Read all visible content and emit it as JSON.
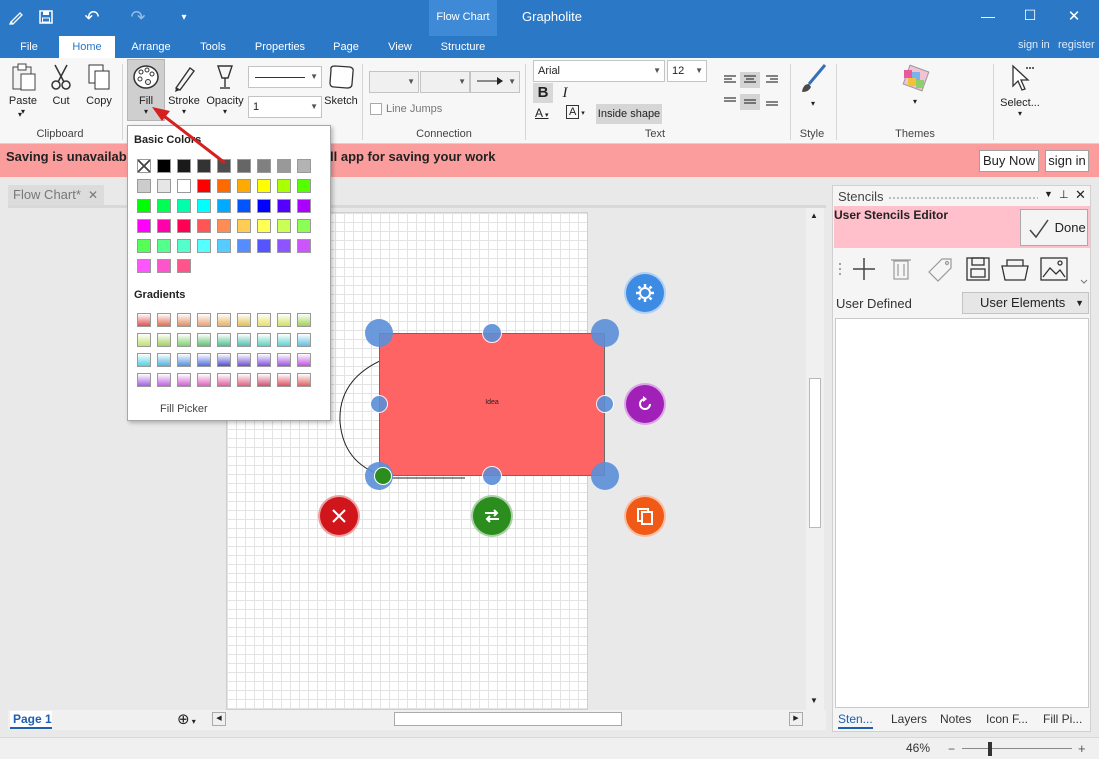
{
  "window": {
    "title": "Grapholite",
    "context_group": "Flow Chart",
    "minimize": "—",
    "maximize": "☐",
    "close": "✕"
  },
  "quick_access": {
    "save": "💾",
    "undo": "↶",
    "redo": "↷",
    "more": "▾"
  },
  "tabs": [
    "File",
    "Home",
    "Arrange",
    "Tools",
    "Properties",
    "Page",
    "View",
    "Structure"
  ],
  "account": {
    "signin": "sign in",
    "register": "register"
  },
  "ribbon": {
    "clipboard": {
      "label": "Clipboard",
      "paste": "Paste",
      "cut": "Cut",
      "copy": "Copy"
    },
    "fill": "Fill",
    "stroke": "Stroke",
    "opacity": "Opacity",
    "sketch": "Sketch",
    "opacity_value": "1",
    "connection": {
      "label": "Connection",
      "line_jumps": "Line Jumps"
    },
    "text": {
      "label": "Text",
      "font": "Arial",
      "size": "12",
      "bold": "B",
      "italic": "I",
      "inside_shape": "Inside shape"
    },
    "style": {
      "label": "Style"
    },
    "themes": {
      "label": "Themes"
    },
    "select": {
      "label": "Select..."
    }
  },
  "notice": {
    "message": "Saving is unavailable",
    "message_tail": "ll app for saving your work",
    "buy_now": "Buy Now",
    "signin": "sign in"
  },
  "doc_tab": {
    "title": "Flow Chart*",
    "close": "✕"
  },
  "fill_popup": {
    "basic_colors_title": "Basic Colors",
    "gradients_title": "Gradients",
    "fill_picker": "Fill Picker",
    "basic_colors": [
      [
        "none",
        "#000000",
        "#1a1a1a",
        "#333333",
        "#4d4d4d",
        "#666666",
        "#808080",
        "#999999",
        "#b3b3b3"
      ],
      [
        "#cccccc",
        "#e6e6e6",
        "#ffffff",
        "#ff0000",
        "#ff6a00",
        "#ffaa00",
        "#ffff00",
        "#aaff00",
        "#55ff00"
      ],
      [
        "#00ff00",
        "#00ff55",
        "#00ffaa",
        "#00ffff",
        "#00aaff",
        "#0055ff",
        "#0000ff",
        "#5500ff",
        "#aa00ff"
      ],
      [
        "#ff00ff",
        "#ff00aa",
        "#ff0055",
        "#ff5555",
        "#ff8c55",
        "#ffcc55",
        "#ffff55",
        "#ccff55",
        "#8cff55"
      ],
      [
        "#55ff55",
        "#55ff8c",
        "#55ffcc",
        "#55ffff",
        "#55ccff",
        "#558cff",
        "#5555ff",
        "#8c55ff",
        "#cc55ff"
      ],
      [
        "#ff55ff",
        "#ff55cc",
        "#ff558c"
      ]
    ],
    "gradients": [
      [
        "#e05050",
        "#e06c50",
        "#e08a60",
        "#e8a070",
        "#e8b060",
        "#e0c050",
        "#e8e060",
        "#d0e060",
        "#a0d050"
      ],
      [
        "#c0e070",
        "#a0d060",
        "#80d070",
        "#60c070",
        "#50c090",
        "#50c0b0",
        "#60d0c0",
        "#60d0d0",
        "#60c0e0"
      ],
      [
        "#50d0e0",
        "#50b0e0",
        "#5090e0",
        "#5070e0",
        "#5050d0",
        "#7050d0",
        "#8050e0",
        "#a050e0",
        "#c050e0"
      ],
      [
        "#a060e0",
        "#c060e0",
        "#d060d0",
        "#e060c0",
        "#e060a0",
        "#e06080",
        "#d05070",
        "#e05060",
        "#e06060"
      ]
    ]
  },
  "canvas": {
    "shape_label": "Idea"
  },
  "page_tab": {
    "label": "Page 1"
  },
  "stencils": {
    "title": "Stencils",
    "editor_title": "User Stencils Editor",
    "done": "Done",
    "category": "User Defined",
    "dropdown": "User Elements",
    "bottom_tabs": [
      "Sten...",
      "Layers",
      "Notes",
      "Icon F...",
      "Fill Pi..."
    ]
  },
  "status": {
    "zoom": "46%"
  },
  "colors": {
    "accent": "#2b78c7",
    "notice": "#fb9d9d",
    "shape": "#fe6464",
    "handle": "#5a8fd8",
    "delete": "#d0161b",
    "swap": "#2a8d1e",
    "copy": "#f05a16",
    "rotate": "#a020b8",
    "settings": "#3d8be3"
  }
}
